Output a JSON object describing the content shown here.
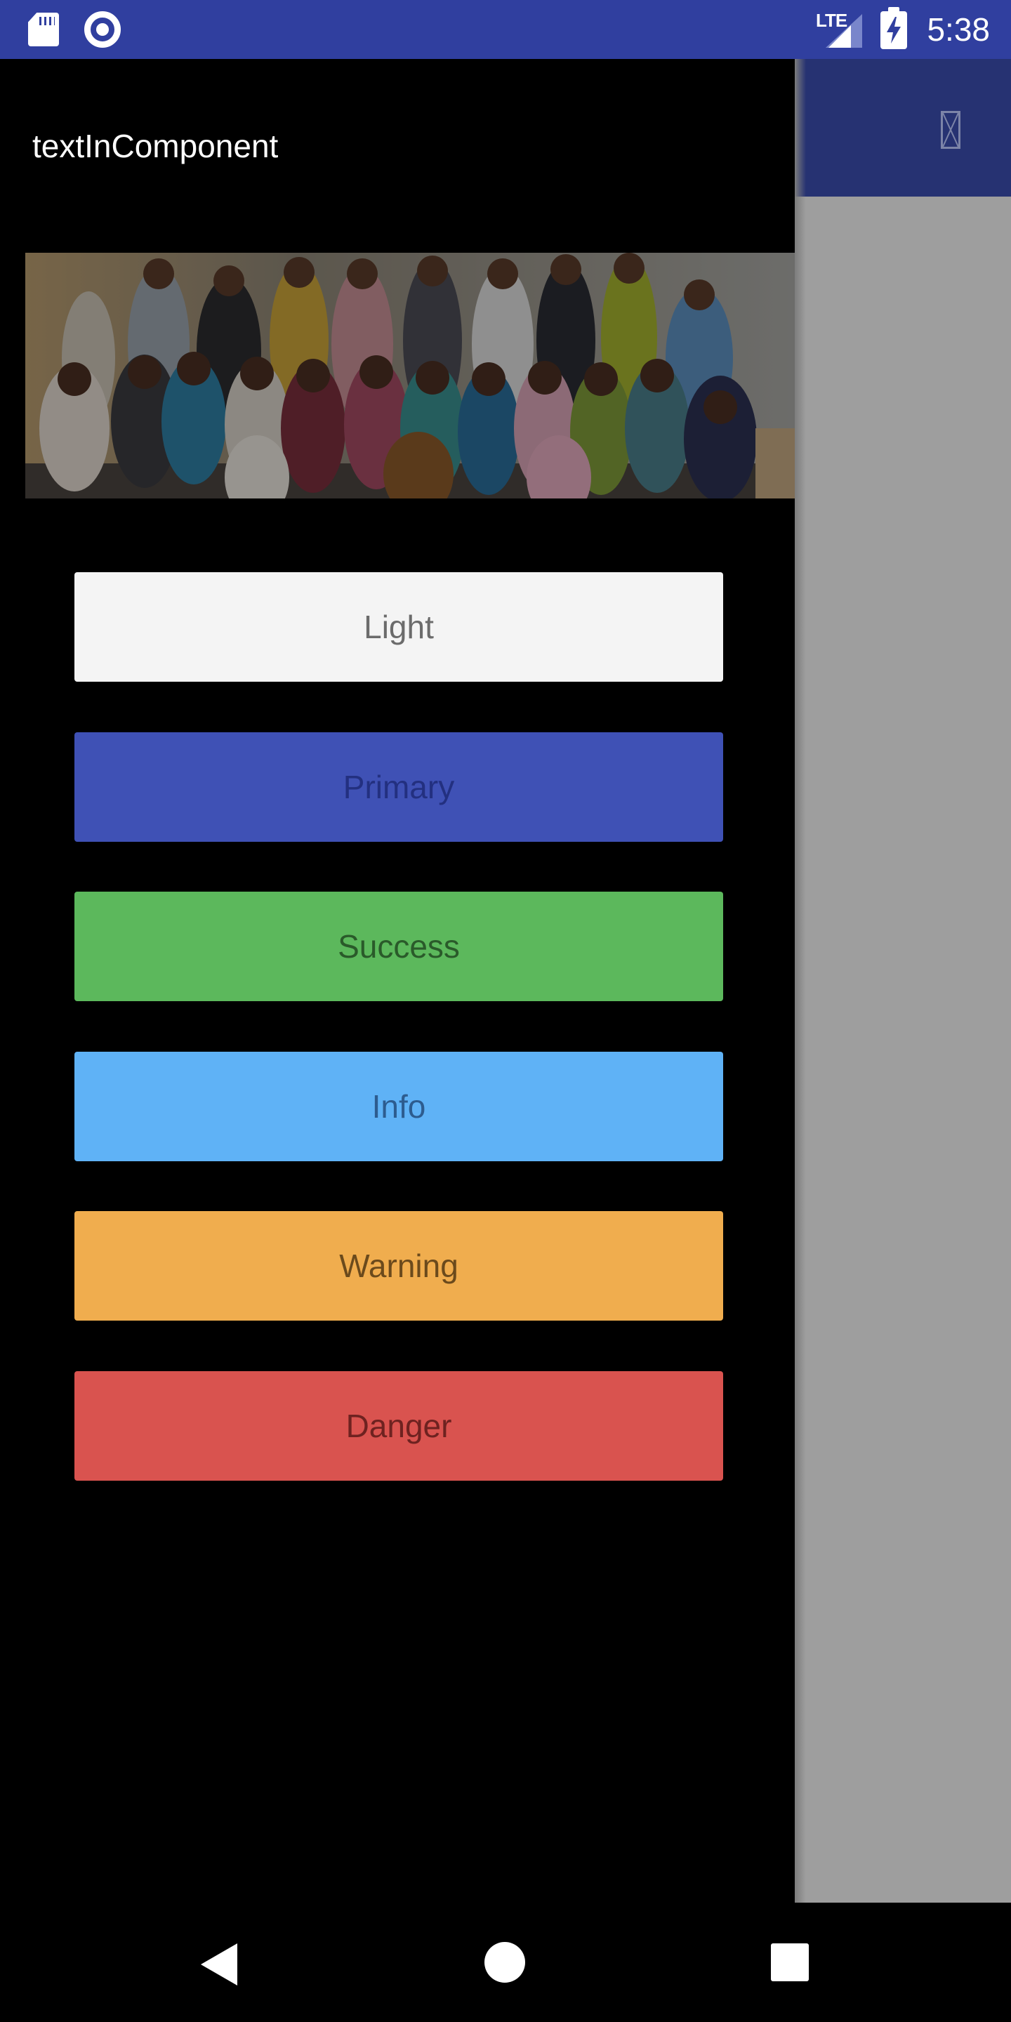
{
  "status_bar": {
    "time": "5:38",
    "network_label": "LTE",
    "color": "#303f9f",
    "icons": [
      "sd-card-icon",
      "sync-icon",
      "signal-icon",
      "battery-charging-icon"
    ]
  },
  "app": {
    "toolbar_color": "#303f9f",
    "toolbar_icon": "missing-glyph-icon"
  },
  "drawer": {
    "title": "textInComponent",
    "header_image": "group-photo",
    "buttons": [
      {
        "label": "Light",
        "color": "#f4f4f4"
      },
      {
        "label": "Primary",
        "color": "#3f51b5"
      },
      {
        "label": "Success",
        "color": "#5cb85c"
      },
      {
        "label": "Info",
        "color": "#5fb2f6"
      },
      {
        "label": "Warning",
        "color": "#f0ad4e"
      },
      {
        "label": "Danger",
        "color": "#d9534f"
      }
    ]
  },
  "nav_bar": {
    "icons": [
      "back-icon",
      "home-icon",
      "recents-icon"
    ]
  }
}
